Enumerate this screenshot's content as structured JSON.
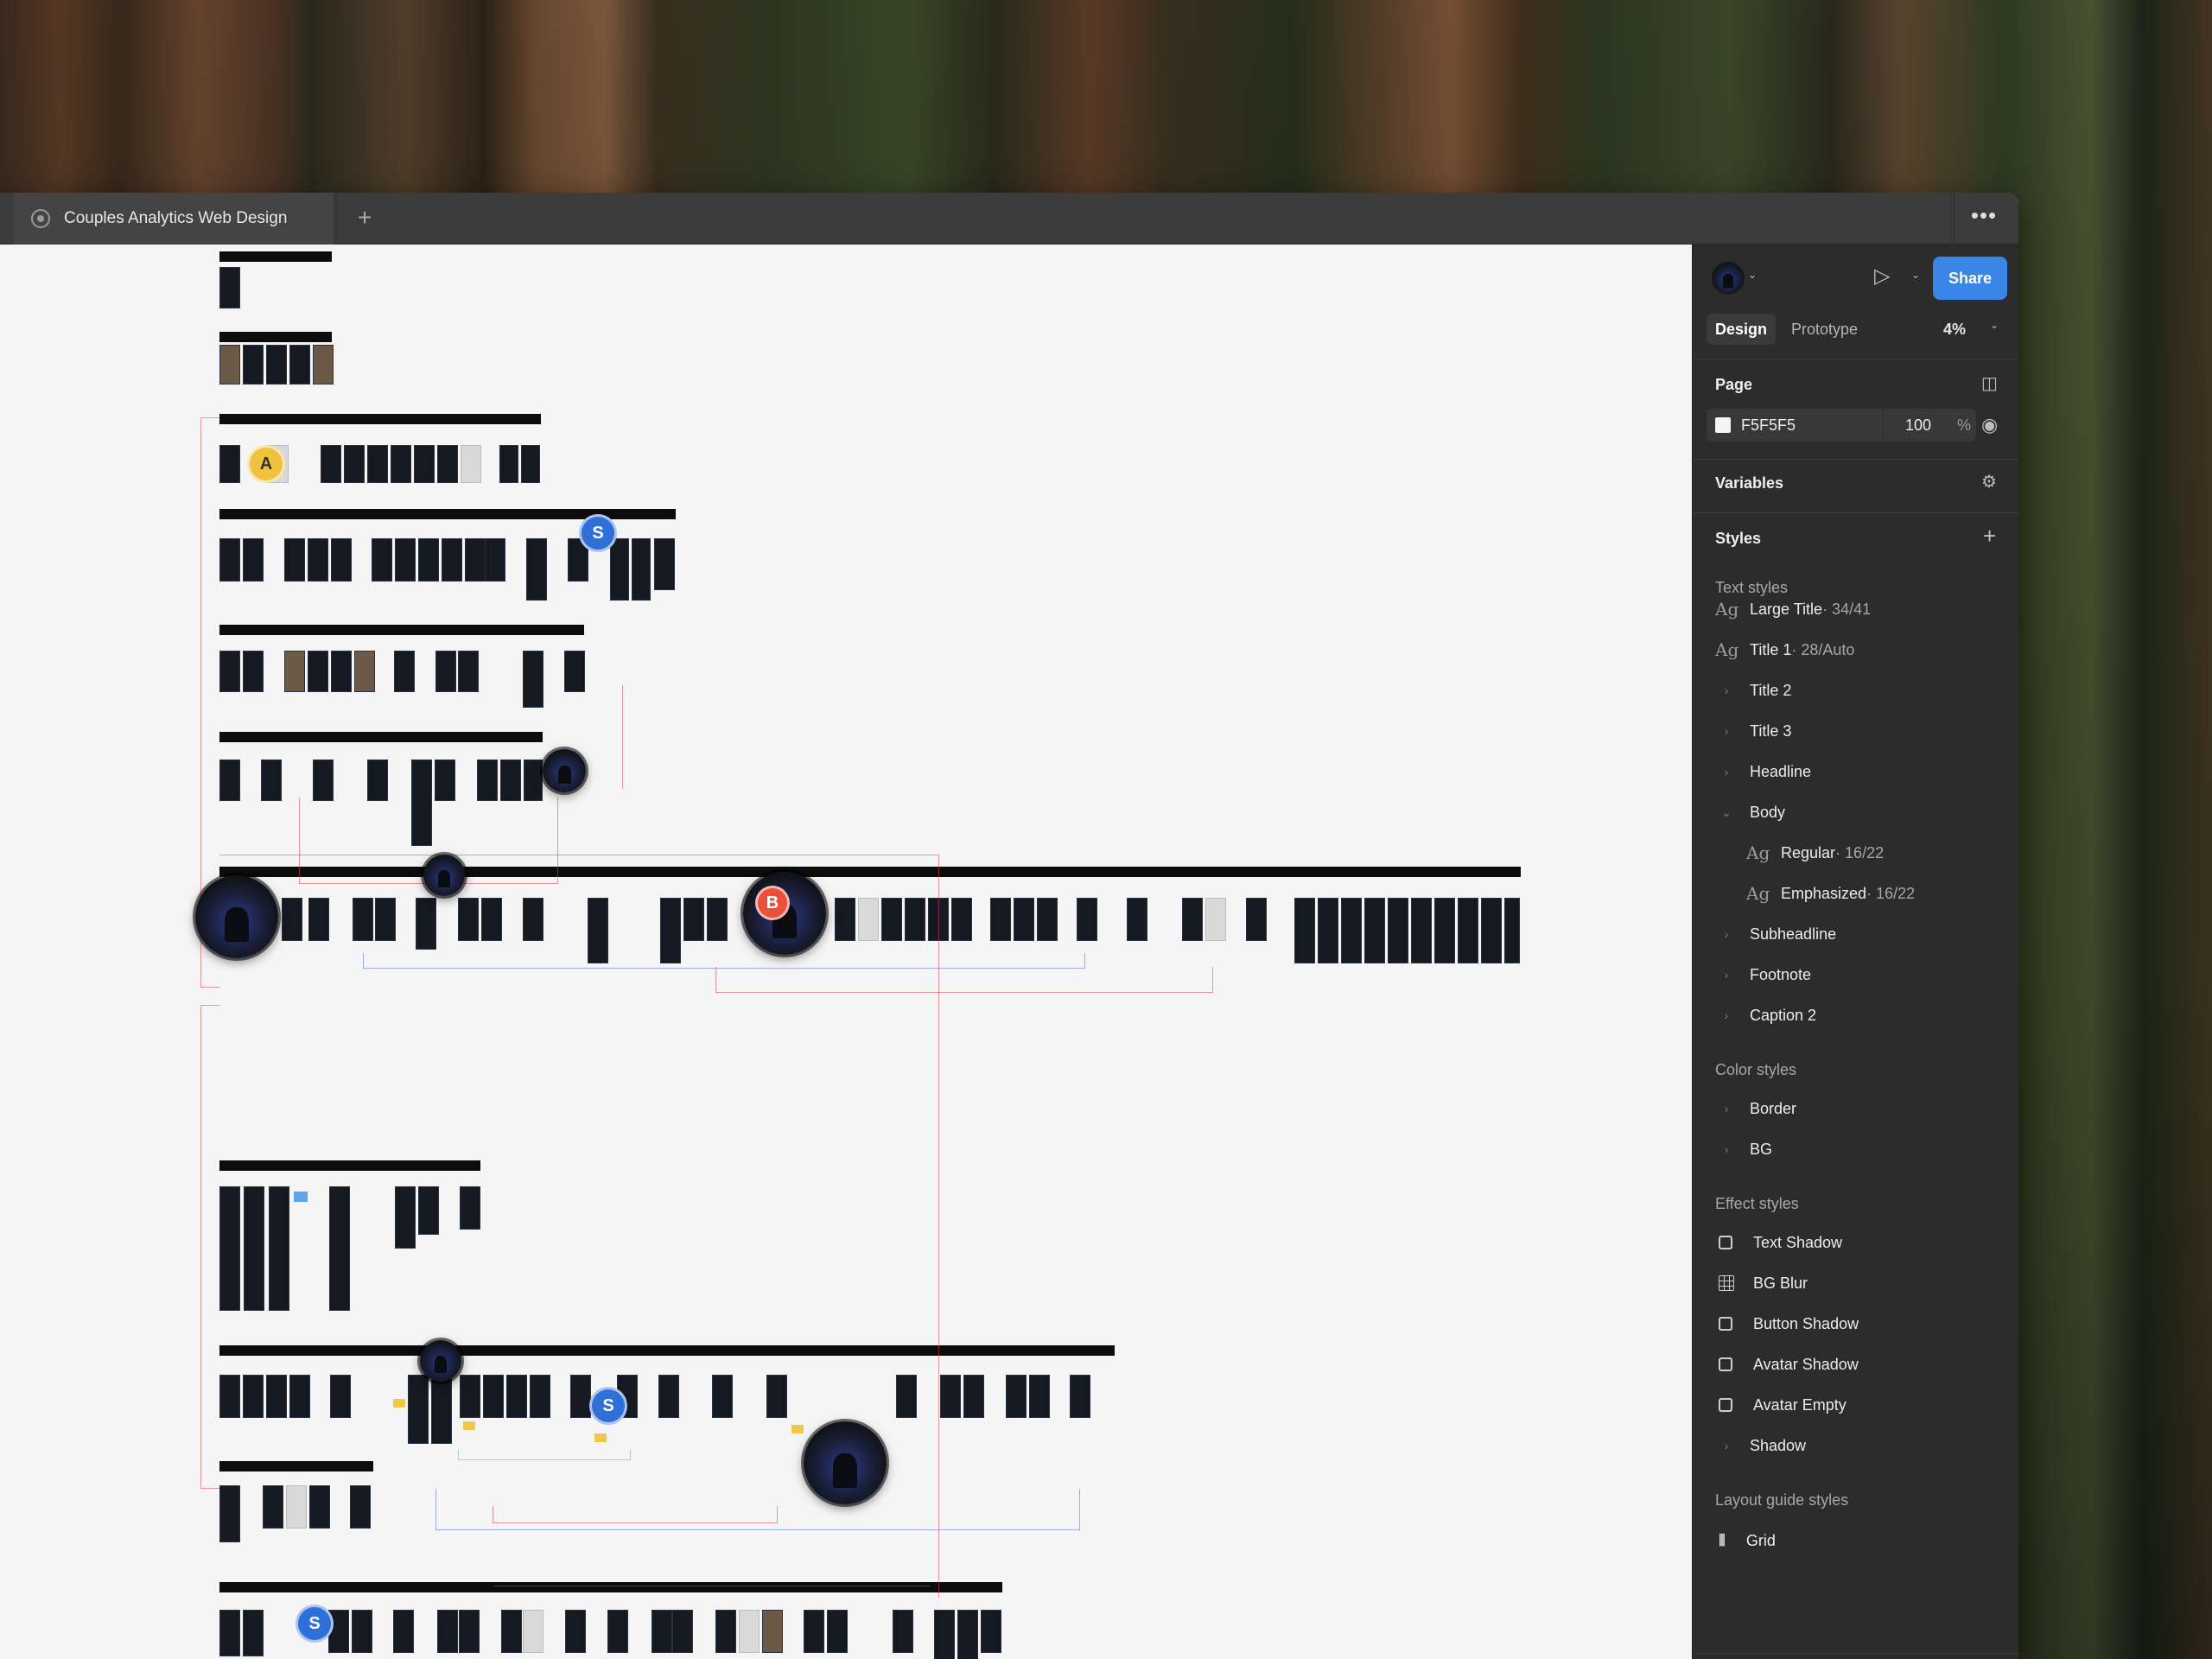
{
  "window": {
    "file_tab_title": "Couples Analytics Web Design",
    "new_tab_symbol": "+",
    "more_symbol": "•••"
  },
  "canvas": {
    "avatar_letters": {
      "a": "A",
      "s": "S",
      "b": "B"
    }
  },
  "panel": {
    "share_label": "Share",
    "tabs": {
      "design": "Design",
      "prototype": "Prototype"
    },
    "zoom": "4%",
    "page": {
      "title": "Page",
      "bg_color_hex": "F5F5F5",
      "opacity": "100",
      "opacity_unit": "%"
    },
    "variables_title": "Variables",
    "styles_title": "Styles",
    "text_styles": {
      "title": "Text styles",
      "items": [
        {
          "name": "Large Title",
          "meta": " · 34/41"
        },
        {
          "name": "Title 1",
          "meta": " · 28/Auto"
        },
        {
          "name": "Title 2"
        },
        {
          "name": "Title 3"
        },
        {
          "name": "Headline"
        },
        {
          "name": "Body"
        },
        {
          "name": "Regular",
          "meta": " · 16/22"
        },
        {
          "name": "Emphasized",
          "meta": " · 16/22"
        },
        {
          "name": "Subheadline"
        },
        {
          "name": "Footnote"
        },
        {
          "name": "Caption 2"
        }
      ]
    },
    "color_styles": {
      "title": "Color styles",
      "items": [
        {
          "name": "Border"
        },
        {
          "name": "BG"
        }
      ]
    },
    "effect_styles": {
      "title": "Effect styles",
      "items": [
        {
          "name": "Text Shadow"
        },
        {
          "name": "BG Blur"
        },
        {
          "name": "Button Shadow"
        },
        {
          "name": "Avatar Shadow"
        },
        {
          "name": "Avatar Empty"
        },
        {
          "name": "Shadow"
        }
      ]
    },
    "layout_guide_styles": {
      "title": "Layout guide styles",
      "items": [
        {
          "name": "Grid"
        }
      ]
    }
  },
  "colors": {
    "accent_blue": "#3a86e8",
    "page_bg": "#f5f5f5",
    "avatar_a": "#f0c23e",
    "avatar_s": "#2f6fd8",
    "avatar_b": "#e8503a"
  }
}
